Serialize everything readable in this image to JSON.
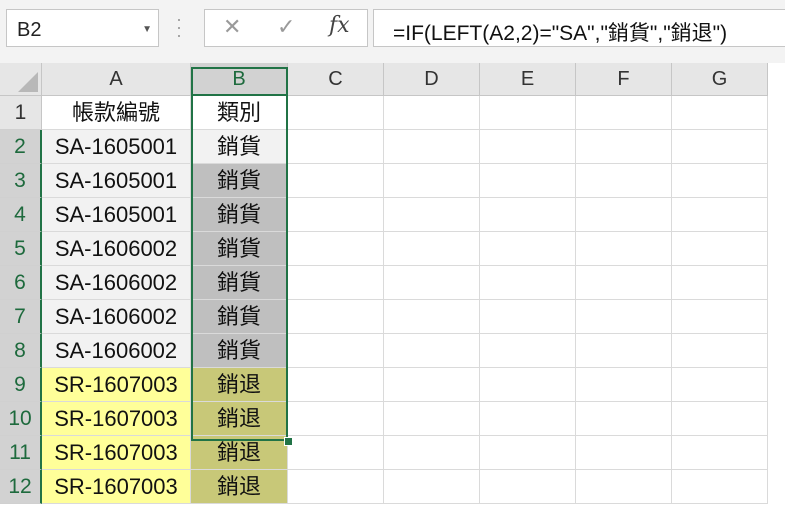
{
  "name_box": {
    "value": "B2"
  },
  "formula_bar": {
    "cancel_glyph": "✕",
    "enter_glyph": "✓",
    "fx_label": "fx",
    "formula": "=IF(LEFT(A2,2)=\"SA\",\"銷貨\",\"銷退\")"
  },
  "columns": [
    "A",
    "B",
    "C",
    "D",
    "E",
    "F",
    "G"
  ],
  "rows": [
    "1",
    "2",
    "3",
    "4",
    "5",
    "6",
    "7",
    "8",
    "9",
    "10",
    "11",
    "12"
  ],
  "cells": [
    [
      "帳款編號",
      "類別"
    ],
    [
      "SA-1605001",
      "銷貨"
    ],
    [
      "SA-1605001",
      "銷貨"
    ],
    [
      "SA-1605001",
      "銷貨"
    ],
    [
      "SA-1606002",
      "銷貨"
    ],
    [
      "SA-1606002",
      "銷貨"
    ],
    [
      "SA-1606002",
      "銷貨"
    ],
    [
      "SA-1606002",
      "銷貨"
    ],
    [
      "SR-1607003",
      "銷退"
    ],
    [
      "SR-1607003",
      "銷退"
    ],
    [
      "SR-1607003",
      "銷退"
    ],
    [
      "SR-1607003",
      "銷退"
    ]
  ],
  "colors": {
    "accent": "#217346",
    "sa_fill": "#f2f2f2",
    "sr_fill": "#ffff99",
    "selection_fill_sa": "#bfbfbf",
    "selection_fill_sr": "#c8c878"
  }
}
